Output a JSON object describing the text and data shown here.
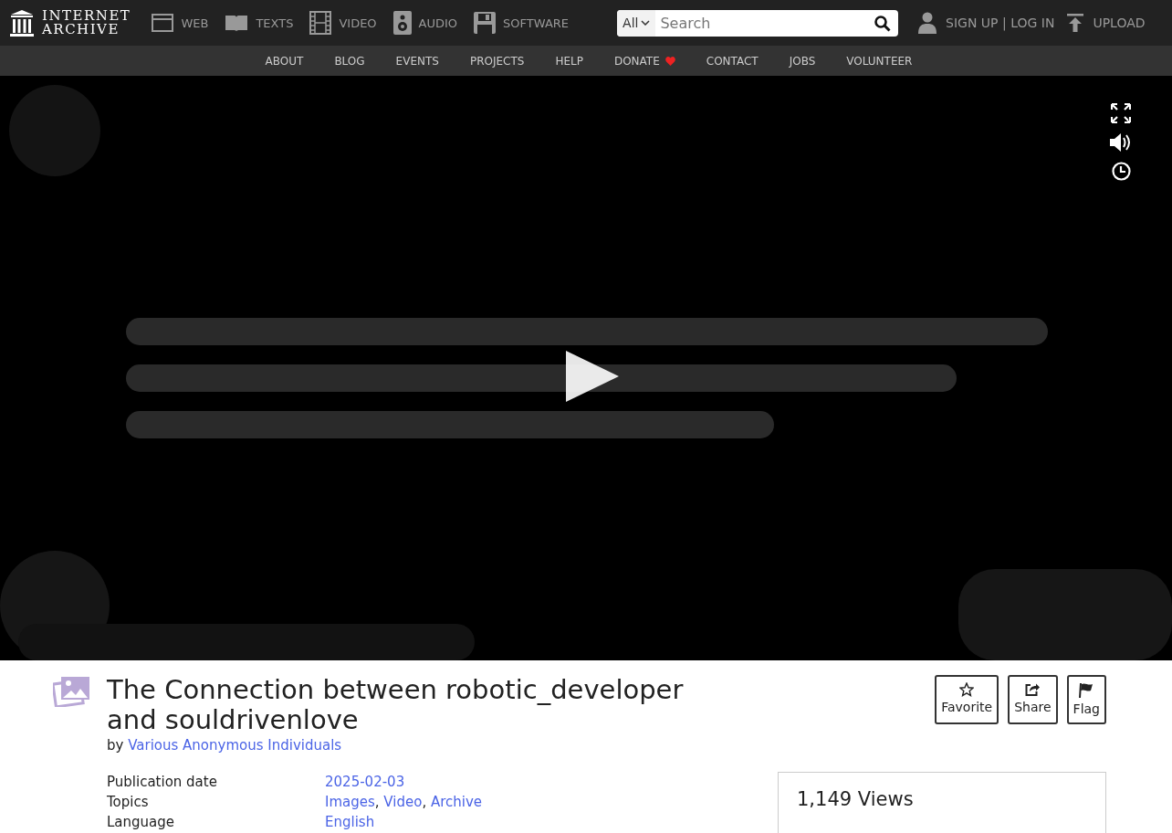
{
  "header": {
    "logo": {
      "line_1": "INTERNET",
      "line_2": "ARCHIVE"
    },
    "media_nav": [
      {
        "label": "WEB",
        "kind": "web"
      },
      {
        "label": "TEXTS",
        "kind": "texts"
      },
      {
        "label": "VIDEO",
        "kind": "video"
      },
      {
        "label": "AUDIO",
        "kind": "audio"
      },
      {
        "label": "SOFTWARE",
        "kind": "software"
      }
    ],
    "search": {
      "scope": "All",
      "placeholder": "Search"
    },
    "sign_up": "SIGN UP",
    "separator": "|",
    "log_in": "LOG IN",
    "upload": "UPLOAD"
  },
  "sub_nav": [
    {
      "label": "ABOUT",
      "kind": "link"
    },
    {
      "label": "BLOG",
      "kind": "link"
    },
    {
      "label": "EVENTS",
      "kind": "link"
    },
    {
      "label": "PROJECTS",
      "kind": "link"
    },
    {
      "label": "HELP",
      "kind": "link"
    },
    {
      "label": "DONATE",
      "kind": "donate"
    },
    {
      "label": "CONTACT",
      "kind": "link"
    },
    {
      "label": "JOBS",
      "kind": "link"
    },
    {
      "label": "VOLUNTEER",
      "kind": "link"
    }
  ],
  "item": {
    "title": "The Connection between robotic_developer and souldrivenlove",
    "byline_prefix": "by",
    "creator": "Various Anonymous Individuals",
    "actions": [
      {
        "label": "Favorite",
        "kind": "favorite"
      },
      {
        "label": "Share",
        "kind": "share"
      },
      {
        "label": "Flag",
        "kind": "flag"
      }
    ],
    "value_separator": ",",
    "metadata": [
      {
        "label": "Publication date",
        "values": [
          "2025-02-03"
        ]
      },
      {
        "label": "Topics",
        "values": [
          "Images",
          "Video",
          "Archive"
        ]
      },
      {
        "label": "Language",
        "values": [
          "English"
        ]
      }
    ],
    "views": "1,149 Views"
  }
}
